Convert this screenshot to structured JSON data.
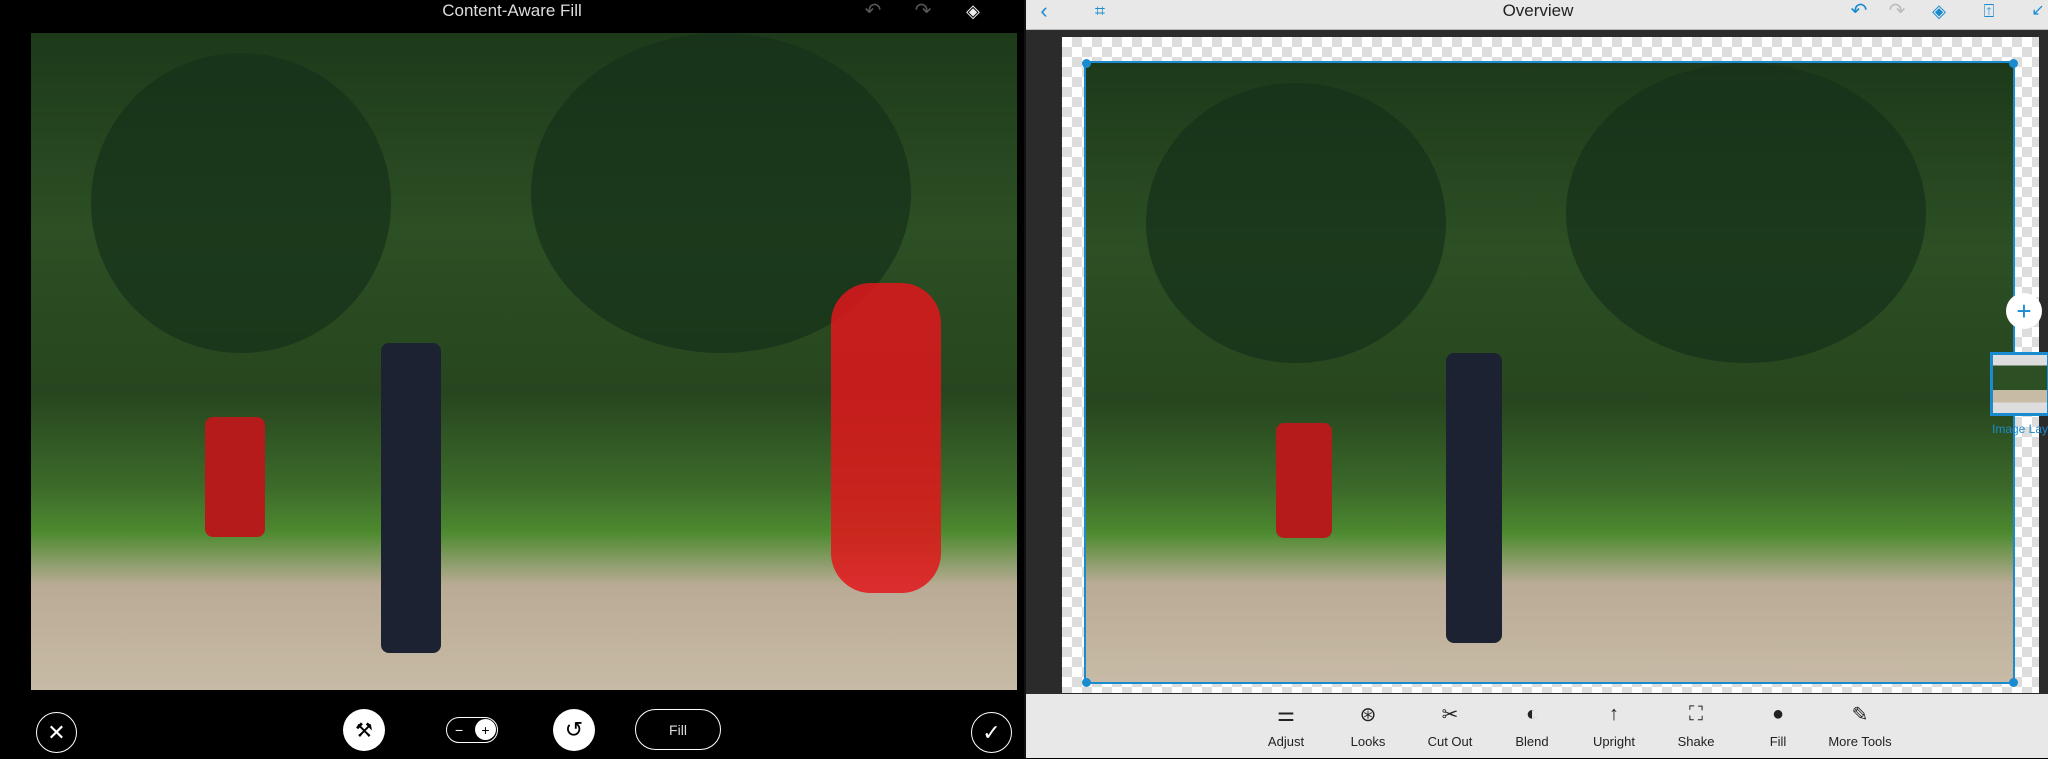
{
  "left": {
    "title": "Content-Aware Fill",
    "toolbar": {
      "fill_label": "Fill"
    },
    "icons": [
      "undo-icon",
      "redo-icon",
      "layers-icon",
      "close-icon",
      "spot-heal-icon",
      "add-subtract-toggle",
      "reset-icon",
      "checkmark-icon"
    ]
  },
  "right": {
    "title": "Overview",
    "layer_label": "Image Layer",
    "tools": [
      {
        "label": "Adjust",
        "icon": "⚌"
      },
      {
        "label": "Looks",
        "icon": "⊛"
      },
      {
        "label": "Cut Out",
        "icon": "✂"
      },
      {
        "label": "Blend",
        "icon": "◐"
      },
      {
        "label": "Upright",
        "icon": "↑"
      },
      {
        "label": "Shake",
        "icon": "⛶"
      },
      {
        "label": "Fill",
        "icon": "●"
      },
      {
        "label": "More Tools",
        "icon": "✎"
      }
    ]
  },
  "colors": {
    "accent": "#1b8bd0",
    "selection_red": "#e0161b"
  }
}
